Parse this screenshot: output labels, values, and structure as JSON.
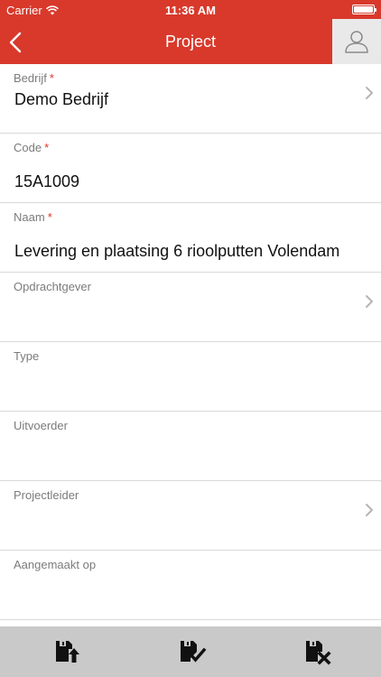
{
  "status_bar": {
    "carrier": "Carrier",
    "time": "11:36 AM"
  },
  "nav": {
    "title": "Project",
    "back_icon": "chevron-left-icon",
    "avatar_icon": "person-icon"
  },
  "fields": [
    {
      "label": "Bedrijf",
      "required": "*",
      "value": "Demo Bedrijf",
      "has_chevron": true
    },
    {
      "label": "Code",
      "required": "*",
      "value": "15A1009",
      "has_chevron": false
    },
    {
      "label": "Naam",
      "required": "*",
      "value": "Levering en plaatsing 6 rioolputten Volendam",
      "has_chevron": false
    },
    {
      "label": "Opdrachtgever",
      "value": "",
      "has_chevron": true
    },
    {
      "label": "Type",
      "value": "",
      "has_chevron": false
    },
    {
      "label": "Uitvoerder",
      "value": "",
      "has_chevron": false
    },
    {
      "label": "Projectleider",
      "value": "",
      "has_chevron": true
    },
    {
      "label": "Aangemaakt op",
      "value": "",
      "has_chevron": false
    }
  ],
  "toolbar": {
    "icons": [
      "save-upload-icon",
      "save-check-icon",
      "save-delete-icon"
    ]
  },
  "colors": {
    "accent": "#d8392b",
    "toolbar": "#c9c9c9",
    "label": "#7b7b7b"
  }
}
